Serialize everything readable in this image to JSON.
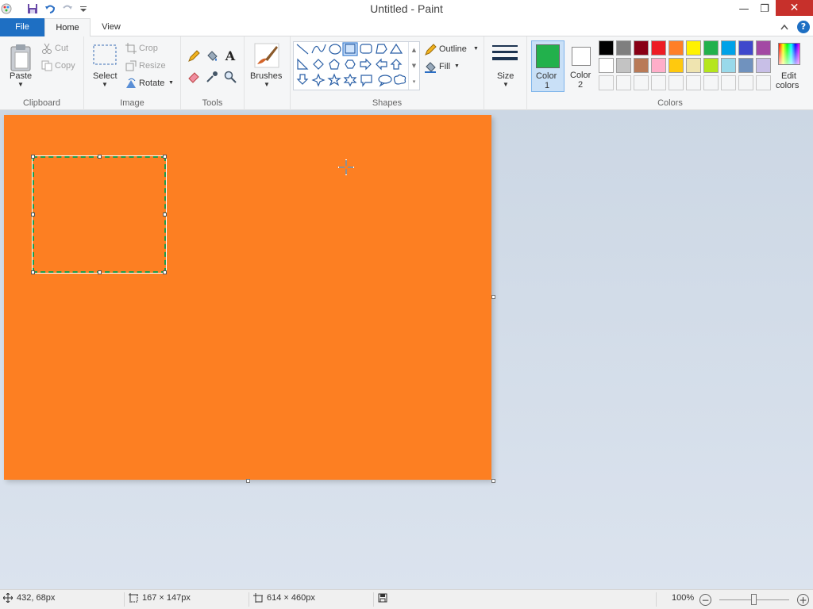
{
  "window": {
    "title": "Untitled - Paint"
  },
  "tabs": {
    "file": "File",
    "home": "Home",
    "view": "View"
  },
  "clipboard": {
    "paste": "Paste",
    "cut": "Cut",
    "copy": "Copy",
    "label": "Clipboard"
  },
  "image": {
    "select": "Select",
    "crop": "Crop",
    "resize": "Resize",
    "rotate": "Rotate",
    "label": "Image"
  },
  "tools": {
    "label": "Tools"
  },
  "brushes": {
    "label": "Brushes"
  },
  "shapes": {
    "outline": "Outline",
    "fill": "Fill",
    "label": "Shapes"
  },
  "size": {
    "label": "Size"
  },
  "colors": {
    "color1_label_1": "Color",
    "color1_label_2": "1",
    "color2_label_1": "Color",
    "color2_label_2": "2",
    "edit_label_1": "Edit",
    "edit_label_2": "colors",
    "label": "Colors",
    "color1": "#22b14c",
    "color2": "#ffffff",
    "palette_row1": [
      "#000000",
      "#7f7f7f",
      "#880015",
      "#ed1c24",
      "#ff7f27",
      "#fff200",
      "#22b14c",
      "#00a2e8",
      "#3f48cc",
      "#a349a4"
    ],
    "palette_row2": [
      "#ffffff",
      "#c3c3c3",
      "#b97a57",
      "#ffaec9",
      "#ffc90e",
      "#efe4b0",
      "#b5e61d",
      "#99d9ea",
      "#7092be",
      "#c8bfe7"
    ]
  },
  "canvas": {
    "fill": "#fd7f22"
  },
  "status": {
    "cursor_pos": "432, 68px",
    "selection_size": "167 × 147px",
    "image_size": "614 × 460px",
    "zoom": "100%"
  }
}
